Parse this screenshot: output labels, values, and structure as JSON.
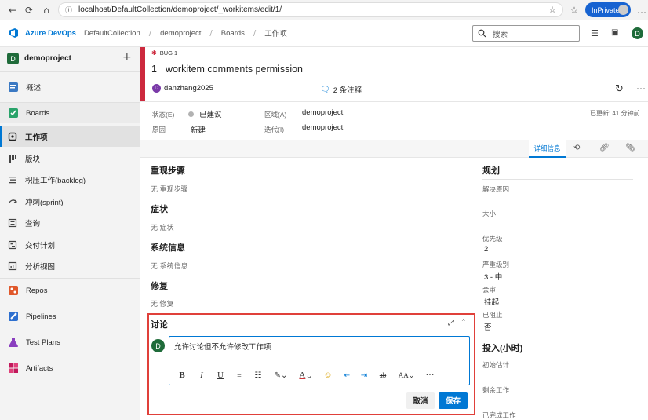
{
  "browser": {
    "url": "localhost/DefaultCollection/demoproject/_workitems/edit/1/",
    "inprivate": "InPrivate"
  },
  "header": {
    "brand": "Azure DevOps",
    "breadcrumbs": [
      "DefaultCollection",
      "demoproject",
      "Boards",
      "工作项"
    ],
    "search_placeholder": "搜索",
    "user_initial": "D"
  },
  "sidebar": {
    "project": "demoproject",
    "project_initial": "D",
    "add": "+",
    "items": [
      {
        "label": "概述",
        "icon": "overview-icon"
      },
      {
        "label": "Boards",
        "icon": "boards-icon"
      },
      {
        "label": "工作项",
        "icon": "work-items-icon"
      },
      {
        "label": "版块",
        "icon": "board-icon"
      },
      {
        "label": "积压工作(backlog)",
        "icon": "backlog-icon"
      },
      {
        "label": "冲刺(sprint)",
        "icon": "sprint-icon"
      },
      {
        "label": "查询",
        "icon": "queries-icon"
      },
      {
        "label": "交付计划",
        "icon": "delivery-plans-icon"
      },
      {
        "label": "分析视图",
        "icon": "analytics-icon"
      },
      {
        "label": "Repos",
        "icon": "repos-icon"
      },
      {
        "label": "Pipelines",
        "icon": "pipelines-icon"
      },
      {
        "label": "Test Plans",
        "icon": "test-plans-icon"
      },
      {
        "label": "Artifacts",
        "icon": "artifacts-icon"
      }
    ]
  },
  "workitem": {
    "type": "BUG 1",
    "id": "1",
    "title": "workitem comments permission",
    "assignee": "danzhang2025",
    "assignee_initial": "D",
    "comments": "2 条注释",
    "fields": {
      "state_label": "状态(E)",
      "state_value": "已建议",
      "reason_label": "原因",
      "reason_value": "新建",
      "area_label": "区域(A)",
      "area_value": "demoproject",
      "iteration_label": "迭代(I)",
      "iteration_value": "demoproject"
    },
    "updated": "已更新: 41 分钟前",
    "tabs": {
      "details": "详细信息"
    }
  },
  "sections": [
    {
      "title": "重现步骤",
      "empty": "无 重现步骤"
    },
    {
      "title": "症状",
      "empty": "无 症状"
    },
    {
      "title": "系统信息",
      "empty": "无 系统信息"
    },
    {
      "title": "修复",
      "empty": "无 修复"
    }
  ],
  "discussion": {
    "title": "讨论",
    "text": "允许讨论但不允许修改工作项",
    "user_initial": "D",
    "cancel": "取消",
    "save": "保存",
    "toolbar": {
      "bold": "B",
      "italic": "I",
      "underline": "U",
      "strike": "ab",
      "font_size": "AA",
      "more": "···",
      "color": "A"
    }
  },
  "planning": {
    "title": "规划",
    "resolution_label": "解决原因",
    "size_label": "大小",
    "priority_label": "优先级",
    "priority_value": "2",
    "severity_label": "严重级别",
    "severity_value": "3 - 中",
    "activity_label": "会审",
    "activity_value": "挂起",
    "blocked_label": "已阻止",
    "blocked_value": "否"
  },
  "effort": {
    "title": "投入(小时)",
    "original_label": "初始估计",
    "remaining_label": "剩余工作",
    "completed_label": "已完成工作"
  },
  "colors": {
    "accent": "#0078d4",
    "bug_red": "#cc293d",
    "highlight": "#e0403a"
  }
}
